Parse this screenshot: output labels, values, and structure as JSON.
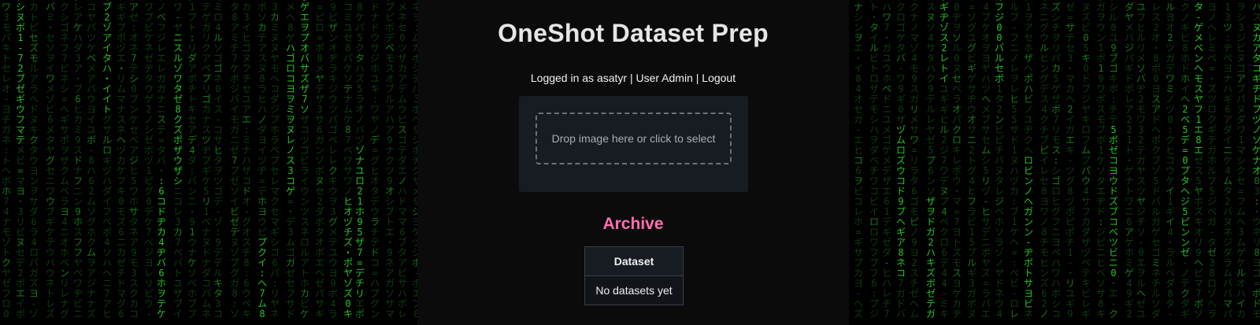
{
  "app": {
    "title": "OneShot Dataset Prep"
  },
  "userbar": {
    "prefix": "Logged in as asatyr",
    "separator": "|",
    "admin_label": "User Admin",
    "logout_label": "Logout"
  },
  "upload": {
    "drop_label": "Drop image here or click to select"
  },
  "archive": {
    "title": "Archive",
    "columns": [
      "Dataset"
    ],
    "empty_message": "No datasets yet"
  },
  "theme": {
    "background": "#000000",
    "panel": "#0b0b0c",
    "rain_green": "#27c427",
    "accent_pink": "#ff6fae"
  }
}
